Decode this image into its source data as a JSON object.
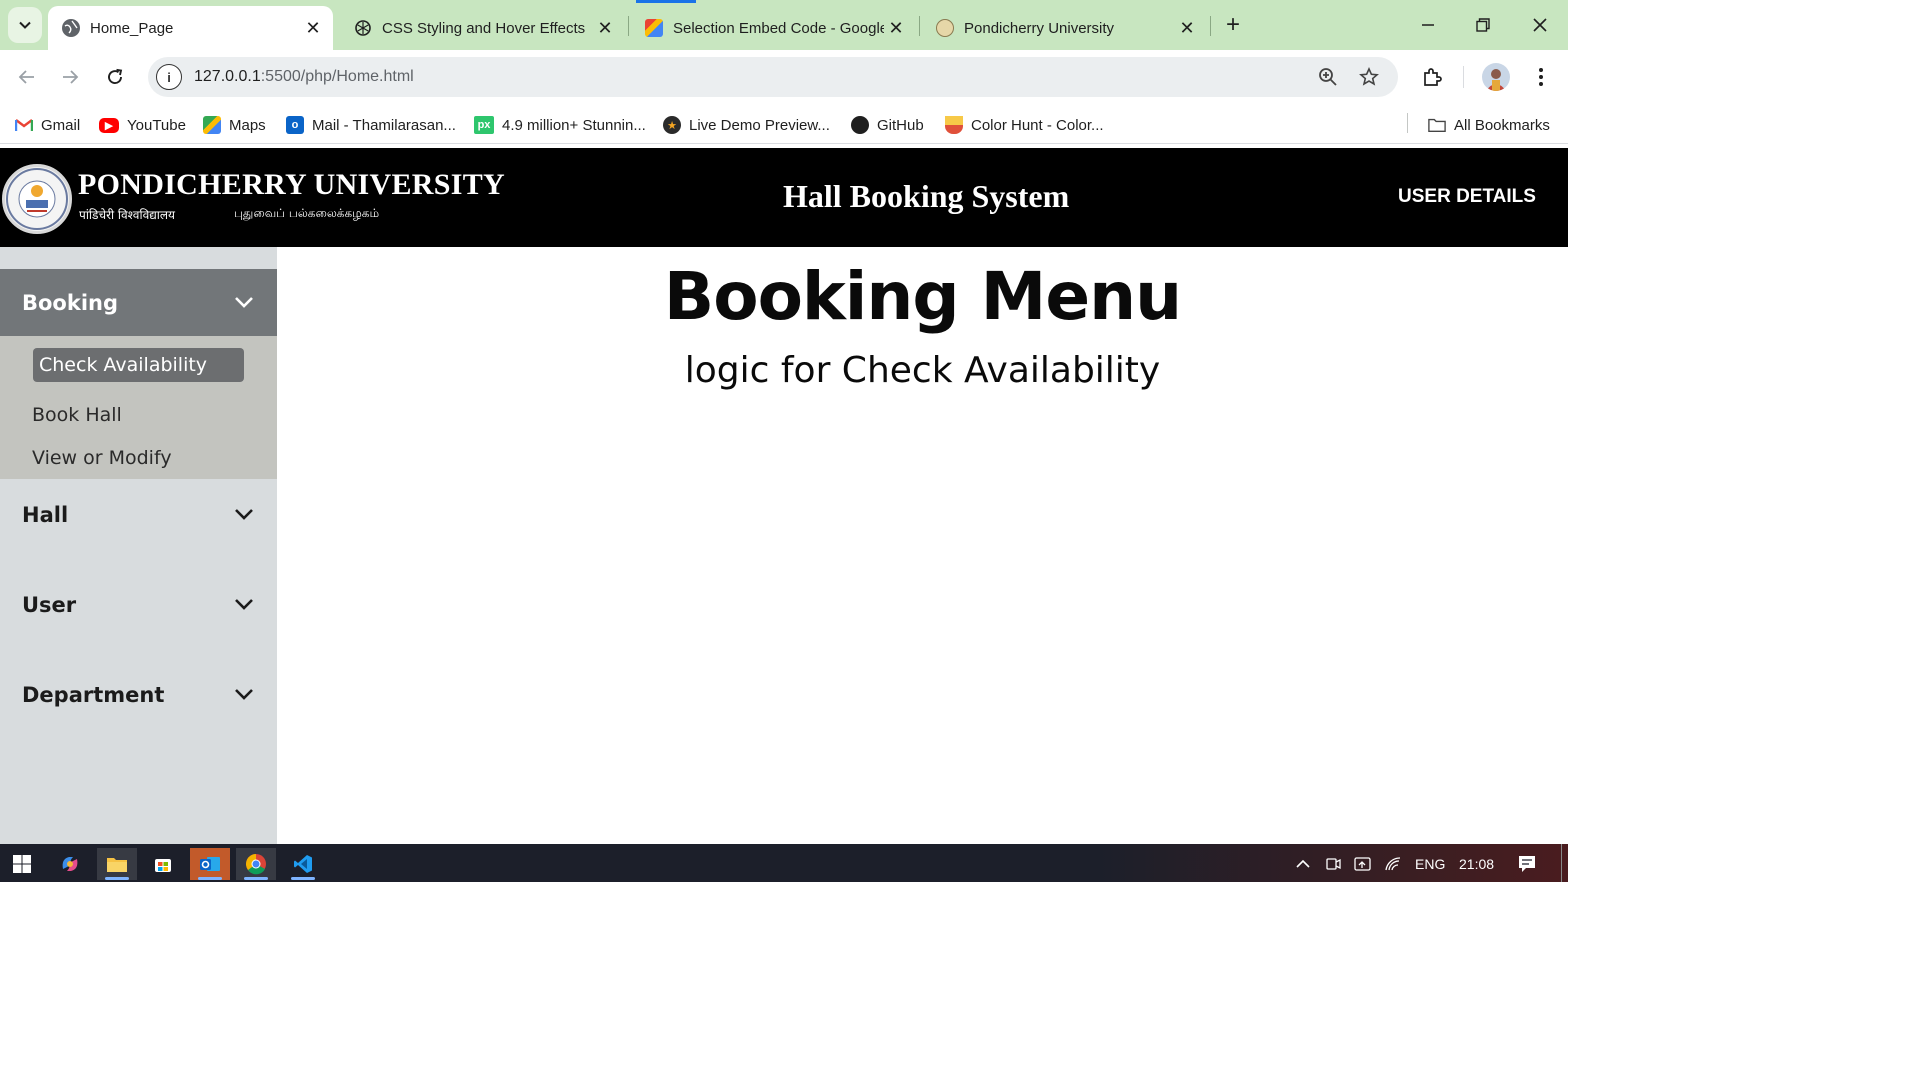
{
  "browser": {
    "tabs": [
      {
        "title": "Home_Page",
        "icon": "globe-icon"
      },
      {
        "title": "CSS Styling and Hover Effects",
        "icon": "openai-icon"
      },
      {
        "title": "Selection Embed Code - Google",
        "icon": "google-embed-icon"
      },
      {
        "title": "Pondicherry University",
        "icon": "university-seal-icon"
      }
    ],
    "new_tab": "+",
    "url_host": "127.0.0.1",
    "url_rest": ":5500/php/Home.html",
    "bookmarks": [
      {
        "label": "Gmail",
        "icon": "gmail-icon"
      },
      {
        "label": "YouTube",
        "icon": "youtube-icon"
      },
      {
        "label": "Maps",
        "icon": "maps-icon"
      },
      {
        "label": "Mail - Thamilarasan...",
        "icon": "outlook-icon"
      },
      {
        "label": "4.9 million+ Stunnin...",
        "icon": "pixabay-icon"
      },
      {
        "label": "Live Demo Preview...",
        "icon": "star-badge-icon"
      },
      {
        "label": "GitHub",
        "icon": "github-icon"
      },
      {
        "label": "Color Hunt - Color...",
        "icon": "colorhunt-icon"
      }
    ],
    "all_bookmarks": "All Bookmarks"
  },
  "site": {
    "university_en": "PONDICHERRY UNIVERSITY",
    "university_hi": "पांडिचेरी विश्वविद्यालय",
    "university_ta": "புதுவைப் பல்கலைக்கழகம்",
    "system_title": "Hall Booking System",
    "user_details": "USER DETAILS"
  },
  "sidebar": {
    "sections": [
      {
        "label": "Booking",
        "expanded": true
      },
      {
        "label": "Hall",
        "expanded": false
      },
      {
        "label": "User",
        "expanded": false
      },
      {
        "label": "Department",
        "expanded": false
      }
    ],
    "booking_items": [
      {
        "label": "Check Availability",
        "selected": true
      },
      {
        "label": "Book Hall",
        "selected": false
      },
      {
        "label": "View or Modify",
        "selected": false
      }
    ]
  },
  "main": {
    "title": "Booking Menu",
    "subtitle": "logic for Check Availability"
  },
  "taskbar": {
    "language": "ENG",
    "time": "21:08"
  },
  "colors": {
    "tabbar": "#c8e6c0",
    "header": "#000000",
    "sidebar": "#d8dcde",
    "sidebar_active": "#727679",
    "submenu": "#c3c4bf"
  }
}
